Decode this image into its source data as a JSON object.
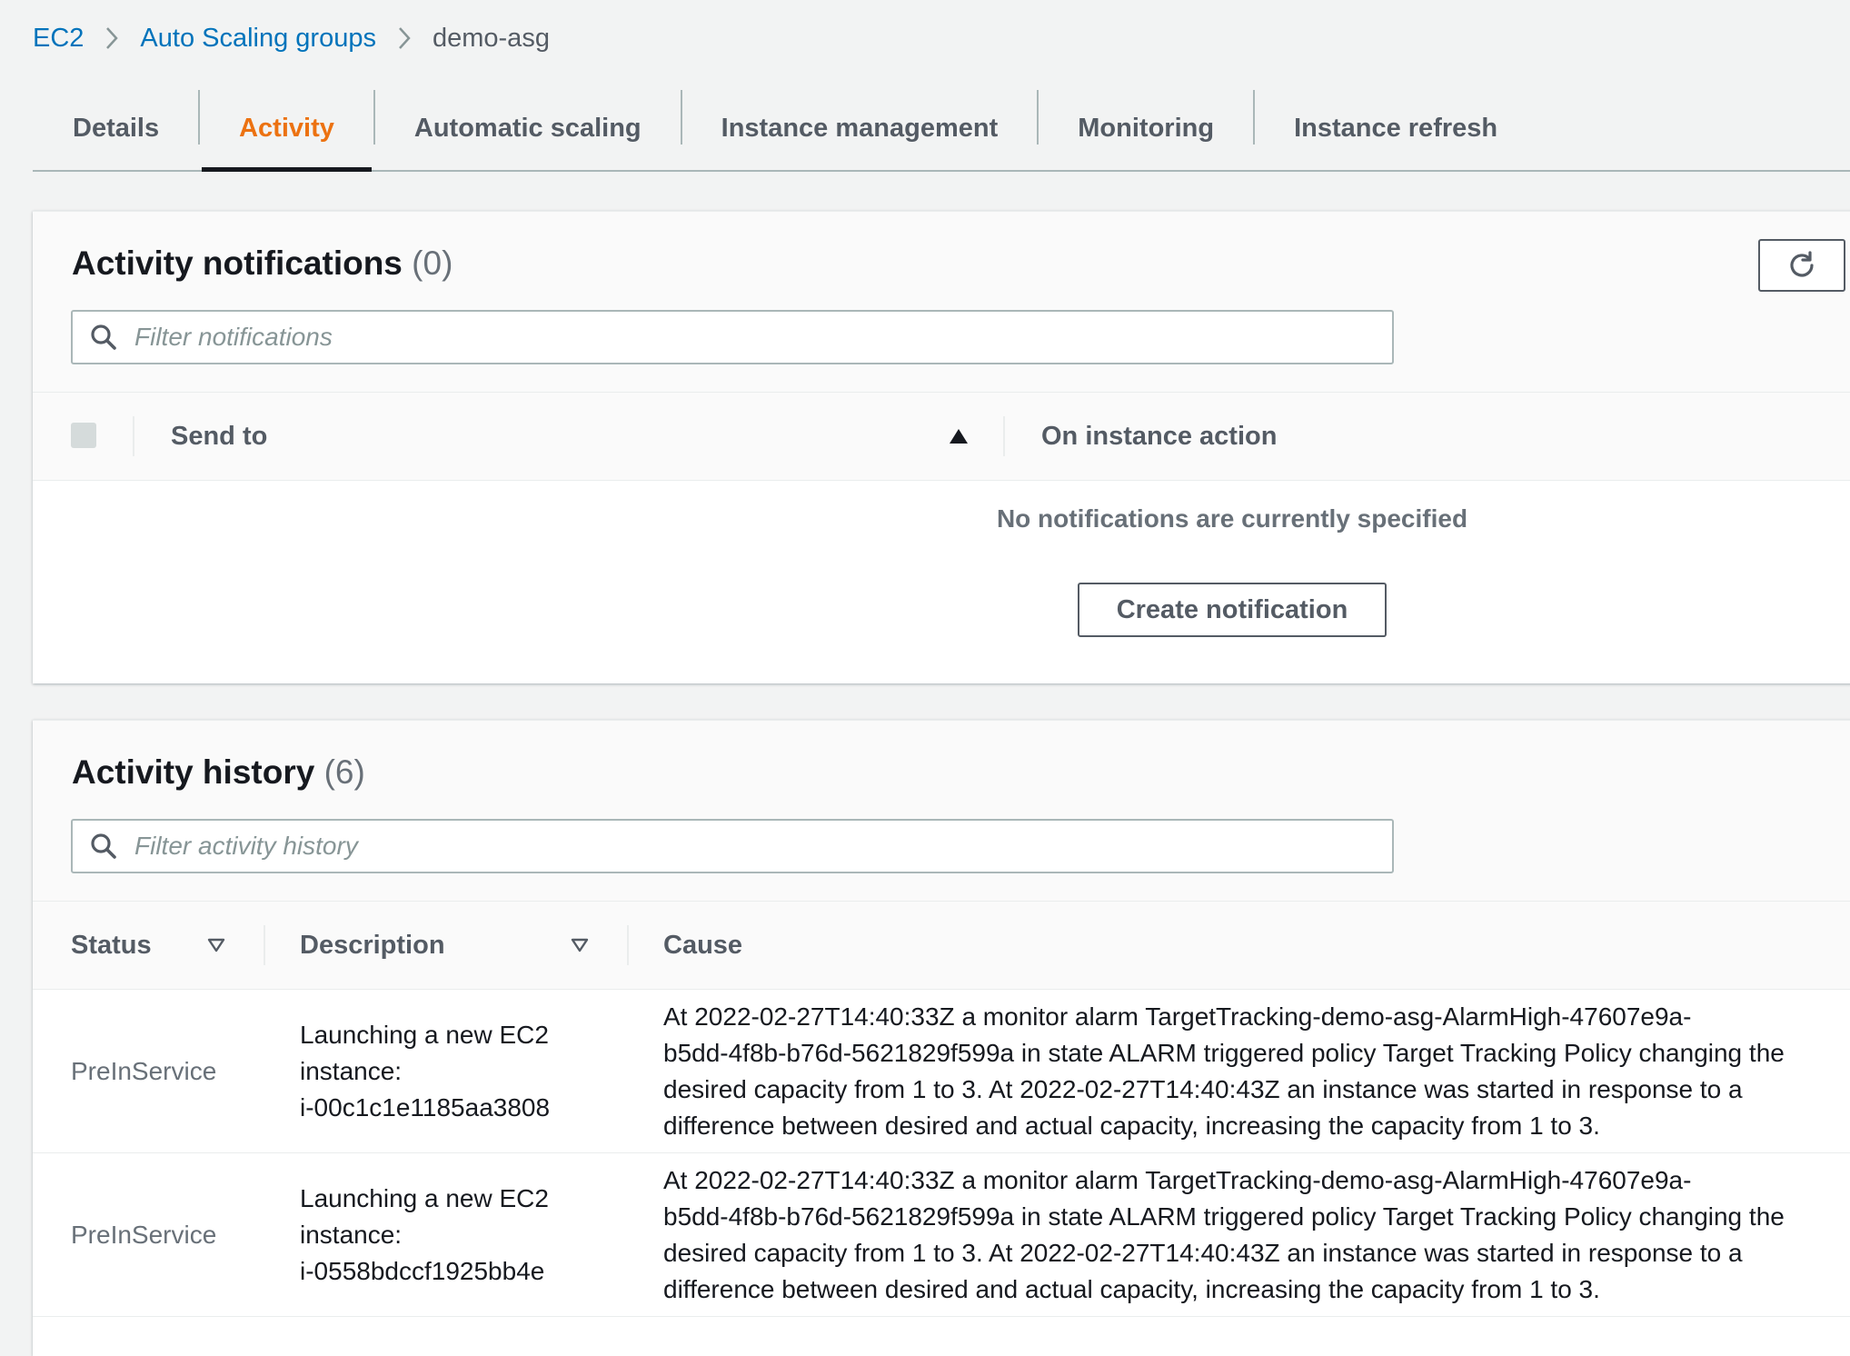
{
  "breadcrumb": {
    "items": [
      "EC2",
      "Auto Scaling groups"
    ],
    "current": "demo-asg"
  },
  "tabs": [
    {
      "label": "Details",
      "active": false
    },
    {
      "label": "Activity",
      "active": true
    },
    {
      "label": "Automatic scaling",
      "active": false
    },
    {
      "label": "Instance management",
      "active": false
    },
    {
      "label": "Monitoring",
      "active": false
    },
    {
      "label": "Instance refresh",
      "active": false
    }
  ],
  "notifications": {
    "title": "Activity notifications",
    "count": "(0)",
    "filter_placeholder": "Filter notifications",
    "columns": [
      "Send to",
      "On instance action"
    ],
    "empty_text": "No notifications are currently specified",
    "create_label": "Create notification"
  },
  "history": {
    "title": "Activity history",
    "count": "(6)",
    "filter_placeholder": "Filter activity history",
    "columns": [
      "Status",
      "Description",
      "Cause"
    ],
    "rows": [
      {
        "status": "PreInService",
        "description": [
          "Launching a new EC2",
          "instance:",
          "i-00c1c1e1185aa3808"
        ],
        "cause": [
          "At 2022-02-27T14:40:33Z a monitor alarm TargetTracking-demo-asg-AlarmHigh-47607e9a-",
          "b5dd-4f8b-b76d-5621829f599a in state ALARM triggered policy Target Tracking Policy changing the",
          "desired capacity from 1 to 3. At 2022-02-27T14:40:43Z an instance was started in response to a",
          "difference between desired and actual capacity, increasing the capacity from 1 to 3."
        ]
      },
      {
        "status": "PreInService",
        "description": [
          "Launching a new EC2",
          "instance:",
          "i-0558bdccf1925bb4e"
        ],
        "cause": [
          "At 2022-02-27T14:40:33Z a monitor alarm TargetTracking-demo-asg-AlarmHigh-47607e9a-",
          "b5dd-4f8b-b76d-5621829f599a in state ALARM triggered policy Target Tracking Policy changing the",
          "desired capacity from 1 to 3. At 2022-02-27T14:40:43Z an instance was started in response to a",
          "difference between desired and actual capacity, increasing the capacity from 1 to 3."
        ]
      }
    ]
  },
  "colors": {
    "link": "#0073bb",
    "active_tab": "#ec7211",
    "background": "#f2f3f3"
  },
  "icons": [
    "chevron-right-icon",
    "refresh-icon",
    "search-icon",
    "sort-asc-icon",
    "filter-caret-icon"
  ]
}
